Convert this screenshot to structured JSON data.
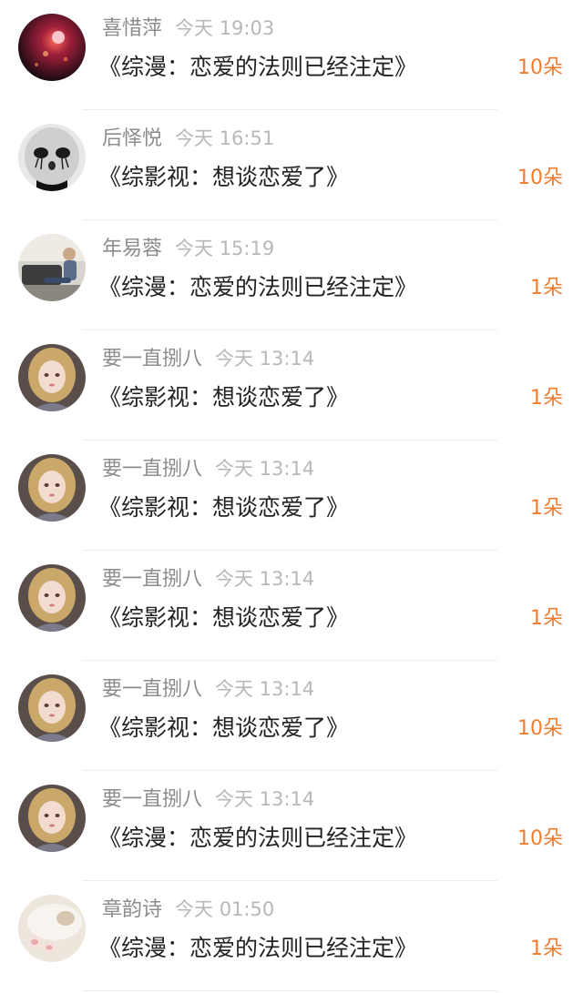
{
  "colors": {
    "gift_count": "#f07c2e",
    "title_text": "#222222",
    "username": "#8c8c8c",
    "timestamp": "#b8b8b8",
    "divider": "#ececec"
  },
  "items": [
    {
      "username": "喜惜萍",
      "time": "今天 19:03",
      "title": "《综漫：恋爱的法则已经注定》",
      "gift": "10朵",
      "avatar": "avatar-red-lights"
    },
    {
      "username": "后怿悦",
      "time": "今天 16:51",
      "title": "《综影视：想谈恋爱了》",
      "gift": "10朵",
      "avatar": "avatar-mask-face"
    },
    {
      "username": "年易蓉",
      "time": "今天 15:19",
      "title": "《综漫：恋爱的法则已经注定》",
      "gift": "1朵",
      "avatar": "avatar-man-sofa"
    },
    {
      "username": "要一直捌八",
      "time": "今天 13:14",
      "title": "《综影视：想谈恋爱了》",
      "gift": "1朵",
      "avatar": "avatar-blonde-girl"
    },
    {
      "username": "要一直捌八",
      "time": "今天 13:14",
      "title": "《综影视：想谈恋爱了》",
      "gift": "1朵",
      "avatar": "avatar-blonde-girl"
    },
    {
      "username": "要一直捌八",
      "time": "今天 13:14",
      "title": "《综影视：想谈恋爱了》",
      "gift": "1朵",
      "avatar": "avatar-blonde-girl"
    },
    {
      "username": "要一直捌八",
      "time": "今天 13:14",
      "title": "《综影视：想谈恋爱了》",
      "gift": "10朵",
      "avatar": "avatar-blonde-girl"
    },
    {
      "username": "要一直捌八",
      "time": "今天 13:14",
      "title": "《综漫：恋爱的法则已经注定》",
      "gift": "10朵",
      "avatar": "avatar-blonde-girl"
    },
    {
      "username": "章韵诗",
      "time": "今天 01:50",
      "title": "《综漫：恋爱的法则已经注定》",
      "gift": "1朵",
      "avatar": "avatar-cat-paws"
    }
  ]
}
